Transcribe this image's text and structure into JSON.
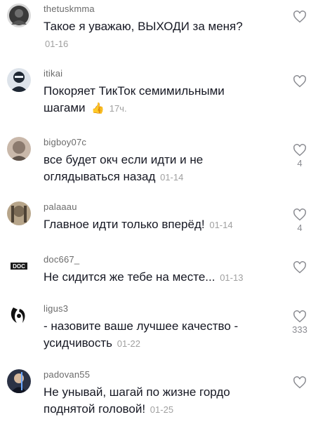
{
  "comments": [
    {
      "username": "thetuskmma",
      "text": "Такое я уважаю, ВЫХОДИ за меня?",
      "date": "01-16",
      "likes": "",
      "avatar_color": "#3a3a3a"
    },
    {
      "username": "itikai",
      "text": "Покоряет ТикТок семимильными шагами",
      "emoji": "👍",
      "date": "17ч.",
      "likes": "",
      "avatar_color": "#1e2733"
    },
    {
      "username": "bigboy07c",
      "text": "все будет окч если идти и не оглядываться назад",
      "date": "01-14",
      "likes": "4",
      "avatar_color": "#8b7a6e"
    },
    {
      "username": "palaaau",
      "text": "Главное идти только вперёд!",
      "date": "01-14",
      "likes": "4",
      "avatar_color": "#7a6a55"
    },
    {
      "username": "doc667_",
      "text": "Не сидится же тебе на месте...",
      "date": "01-13",
      "likes": "",
      "avatar_color": "#ffffff",
      "avatar_label": "DOC"
    },
    {
      "username": "ligus3",
      "text": "- назовите ваше лучшее качество - усидчивость",
      "date": "01-22",
      "likes": "333",
      "avatar_color": "#ffffff"
    },
    {
      "username": "padovan55",
      "text": "Не унывай, шагай по жизне гордо поднятой головой!",
      "date": "01-25",
      "likes": "",
      "avatar_color": "#1a1e2e"
    }
  ]
}
